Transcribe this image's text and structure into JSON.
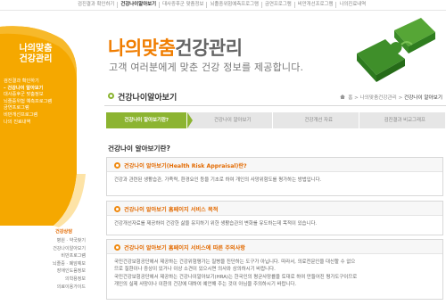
{
  "topnav": {
    "items": [
      {
        "label": "검진결과 확인하기",
        "active": false
      },
      {
        "label": "건강나이알아보기",
        "active": true
      },
      {
        "label": "대사증후군 맞춤정보",
        "active": false
      },
      {
        "label": "뇌졸중위험예측프로그램",
        "active": false
      },
      {
        "label": "금연프로그램",
        "active": false
      },
      {
        "label": "비만개선프로그램",
        "active": false
      },
      {
        "label": "나의진료내역",
        "active": false
      }
    ]
  },
  "sidebar": {
    "title_line1": "나의맞춤",
    "title_line2": "건강관리",
    "menu": [
      {
        "label": "검진결과 확인하기",
        "type": "main"
      },
      {
        "label": "– 건강나이 알아보기",
        "type": "sub-selected"
      },
      {
        "label": "대사증후군 맞춤정보",
        "type": "main"
      },
      {
        "label": "뇌졸중위험 예측프로그램",
        "type": "main"
      },
      {
        "label": "금연프로그램",
        "type": "main"
      },
      {
        "label": "비만개선프로그램",
        "type": "main"
      },
      {
        "label": "나의 진료내역",
        "type": "main"
      }
    ],
    "lower_heading": "건강상담",
    "lower_items": [
      "병원 · 약국찾기",
      "건강나이알아보기",
      "비만프로그램",
      "뇌졸중 · 폐암예보",
      "장애인도움정보",
      "의학용정보",
      "의료이용가이드"
    ]
  },
  "banner": {
    "title_orange": "나의맞춤",
    "title_gray": "건강관리",
    "subtitle": "고객 여러분에게 맞춘 건강 정보를 제공합니다."
  },
  "page": {
    "title": "건강나이알아보기",
    "breadcrumb_home": "홈",
    "breadcrumb_mid": "나의맞춤건강관리",
    "breadcrumb_current": "건강나이 알아보기",
    "breadcrumb_sep": ">"
  },
  "tabs": [
    {
      "label": "건강나이 알아보기란?",
      "active": true
    },
    {
      "label": "건강나이 알아보기",
      "active": false
    },
    {
      "label": "건강개선 자료",
      "active": false
    },
    {
      "label": "검진결과 비교그래프",
      "active": false
    }
  ],
  "question": "건강나이 알아보기란?",
  "boxes": [
    {
      "heading": "건강나이 알아보기(Health Risk Appraisal)란?",
      "lines": [
        "건강과 관련된 생활습관, 가족력, 환경요인 등을 기초로 하여 개인의 사망위험도를 평가하는 방법입니다."
      ]
    },
    {
      "heading": "건강나이 알아보기 홈페이지 서비스 목적",
      "lines": [
        "건강개선자료를 제공하여 건강한 삶을 유지하기 위한 생활습관의 변화를 유도하는데 목적이 있습니다."
      ]
    },
    {
      "heading": "건강나이 알아보기 홈페이지 서비스에 따른 주의사항",
      "lines": [
        "국민건강보험공단에서 제공하는 건강위험평가는 질병을 진단하는 도구가 아닙니다. 따라서, 의료전문인을 대신할 수 없으",
        "므로 질환이나 증상이 있거나 이상 소견이 있으시면 의사와 상의하시기 바랍니다.",
        "국민건강보험공단에서 제공하는 건강나이알아보기(HRA)는 한국인의 평균사망률을 토대로 하여 만들어진 평가도구이므로",
        "개인의 실제 사망이나 이환의 건강에 대하여 예언해 주는 것이 아님을 주의하시기 바랍니다."
      ]
    }
  ],
  "colors": {
    "orange": "#f07d00",
    "green": "#8cb431",
    "text": "#666666"
  }
}
